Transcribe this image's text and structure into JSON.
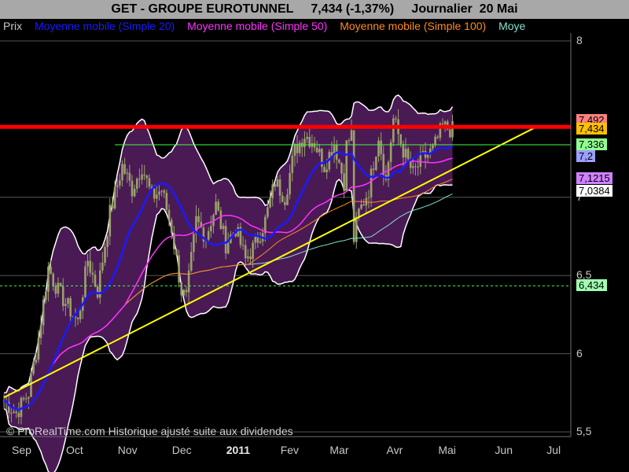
{
  "title": "GET - GROUPE EUROTUNNEL     7,434 (-1,37%)     Journalier  20 Mai",
  "legend": {
    "prix": "Prix",
    "items": [
      {
        "label": "Moyenne mobile (Simple 20)",
        "color": "#1a1aff"
      },
      {
        "label": "Moyenne mobile (Simple 50)",
        "color": "#ff33ff"
      },
      {
        "label": "Moyenne mobile (Simple 100)",
        "color": "#ff8a1a"
      },
      {
        "label": "Moye",
        "color": "#80e0d0"
      }
    ]
  },
  "credit": "© ProRealTime.com Historique ajusté suite aux dividendes",
  "value_boxes": [
    {
      "text": "7,492",
      "value": 7.492,
      "bg": "#ff8080"
    },
    {
      "text": "7,434",
      "value": 7.434,
      "bg": "#ffc000"
    },
    {
      "text": "7,336",
      "value": 7.336,
      "bg": "#90ff90"
    },
    {
      "text": "7,2",
      "value": 7.26,
      "bg": "#9aa0ff"
    },
    {
      "text": "7,1215",
      "value": 7.1215,
      "bg": "#d080ff"
    },
    {
      "text": "7,0384",
      "value": 7.0384,
      "bg": "#ffffff"
    },
    {
      "text": "6,434",
      "value": 6.434,
      "bg": "#a0ffb0"
    }
  ],
  "chart_data": {
    "type": "candlestick",
    "y_ticks": [
      {
        "value": 8,
        "label": "8"
      },
      {
        "value": 7,
        "label": "7"
      },
      {
        "value": 6.5,
        "label": "6,5"
      },
      {
        "value": 6,
        "label": "6"
      },
      {
        "value": 5.5,
        "label": "5,5"
      }
    ],
    "ylim": [
      5.47,
      8.05
    ],
    "x_ticks": [
      {
        "t": 0,
        "label": "Sep",
        "year": false
      },
      {
        "t": 22,
        "label": "Oct",
        "year": false
      },
      {
        "t": 43,
        "label": "Nov",
        "year": false
      },
      {
        "t": 65,
        "label": "Dec",
        "year": false
      },
      {
        "t": 87,
        "label": "2011",
        "year": true
      },
      {
        "t": 109,
        "label": "Fev",
        "year": false
      },
      {
        "t": 129,
        "label": "Mar",
        "year": false
      },
      {
        "t": 152,
        "label": "Avr",
        "year": false
      },
      {
        "t": 173,
        "label": "Mai",
        "year": false
      },
      {
        "t": 196,
        "label": "Jun",
        "year": false
      },
      {
        "t": 217,
        "label": "Jul",
        "year": false
      }
    ],
    "price": {
      "close": [
        5.7,
        5.62,
        5.75,
        6.1,
        6.55,
        6.4,
        6.3,
        6.2,
        6.6,
        6.4,
        6.9,
        7.2,
        7.05,
        7.2,
        7.0,
        7.05,
        6.8,
        6.4,
        6.35,
        6.85,
        6.75,
        6.95,
        6.7,
        6.8,
        6.6,
        6.7,
        6.85,
        7.1,
        7.0,
        7.3,
        7.4,
        7.35,
        7.2,
        7.35,
        7.1,
        7.4,
        7.3,
        6.65,
        6.9,
        7.05,
        7.4,
        7.1,
        7.5,
        7.3,
        7.15,
        7.25,
        7.3,
        7.45,
        7.43
      ],
      "t": [
        0,
        5,
        10,
        14,
        18,
        22,
        26,
        30,
        34,
        38,
        43,
        48,
        52,
        56,
        60,
        64,
        68,
        72,
        74,
        78,
        82,
        86,
        90,
        94,
        98,
        102,
        106,
        110,
        114,
        118,
        122,
        126,
        130,
        134,
        138,
        141,
        138,
        141,
        144,
        148,
        152,
        155,
        158,
        162,
        166,
        170,
        174,
        178,
        182
      ],
      "resistance": 7.45,
      "support_green": 7.336,
      "support_dashed": 6.434,
      "trendline": {
        "t": [
          0,
          216
        ],
        "y": [
          5.72,
          7.45
        ]
      }
    }
  },
  "colors": {
    "background": "#000000",
    "header": "#a8a8a8",
    "band_fill": "#4a1a55",
    "band_edge": "#ffffff",
    "candle": "#9aa06a",
    "ma20": "#1a1aff",
    "ma50": "#ff33ff",
    "ma100": "#ff8a1a",
    "ma200": "#80e0d0",
    "resistance": "#ff0000",
    "trendline": "#ffff00",
    "support": "#40ff40"
  }
}
